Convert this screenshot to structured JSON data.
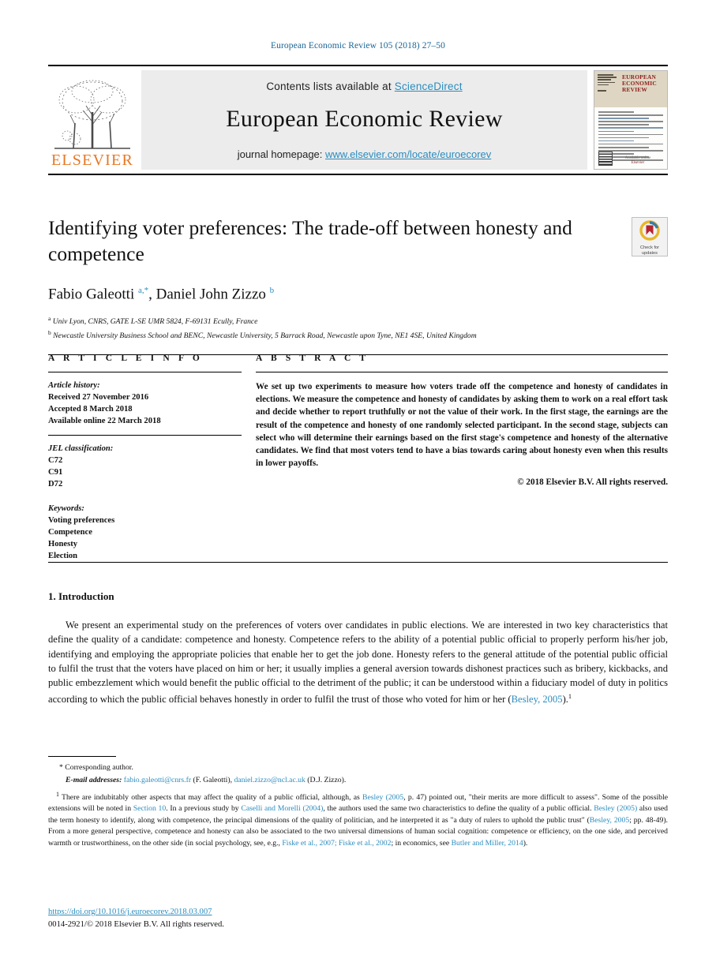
{
  "running_head": "European Economic Review 105 (2018) 27–50",
  "masthead": {
    "contents_prefix": "Contents lists available at ",
    "sciencedirect": "ScienceDirect",
    "journal_name": "European Economic Review",
    "homepage_prefix": "journal homepage: ",
    "homepage_url": "www.elsevier.com/locate/euroecorev",
    "publisher": "ELSEVIER",
    "cover_title": "EUROPEAN ECONOMIC REVIEW",
    "cover_caption": "Elsevier",
    "cover_caption2": "Available online"
  },
  "article": {
    "title": "Identifying voter preferences: The trade-off between honesty and competence",
    "crossmark_label": "Check for updates",
    "authors_html": "Fabio Galeotti <sup>a,*</sup>, Daniel John Zizzo <sup>b</sup>",
    "affiliation_a": "Univ Lyon, CNRS, GATE L-SE UMR 5824, F-69131 Ecully, France",
    "affiliation_b": "Newcastle University Business School and BENC, Newcastle University, 5 Barrack Road, Newcastle upon Tyne, NE1 4SE, United Kingdom"
  },
  "info": {
    "heading": "A R T I C L E   I N F O",
    "history_title": "Article history:",
    "history": [
      "Received 27 November 2016",
      "Accepted 8 March 2018",
      "Available online 22 March 2018"
    ],
    "jel_title": "JEL classification:",
    "jel": [
      "C72",
      "C91",
      "D72"
    ],
    "keywords_title": "Keywords:",
    "keywords": [
      "Voting preferences",
      "Competence",
      "Honesty",
      "Election"
    ]
  },
  "abstract": {
    "heading": "A B S T R A C T",
    "text": "We set up two experiments to measure how voters trade off the competence and honesty of candidates in elections. We measure the competence and honesty of candidates by asking them to work on a real effort task and decide whether to report truthfully or not the value of their work. In the first stage, the earnings are the result of the competence and honesty of one randomly selected participant. In the second stage, subjects can select who will determine their earnings based on the first stage's competence and honesty of the alternative candidates. We find that most voters tend to have a bias towards caring about honesty even when this results in lower payoffs.",
    "copyright": "© 2018 Elsevier B.V. All rights reserved."
  },
  "introduction": {
    "heading": "1. Introduction",
    "paragraph_html": "We present an experimental study on the preferences of voters over candidates in public elections. We are interested in two key characteristics that define the quality of a candidate: competence and honesty. Competence refers to the ability of a potential public official to properly perform his/her job, identifying and employing the appropriate policies that enable her to get the job done. Honesty refers to the general attitude of the potential public official to fulfil the trust that the voters have placed on him or her; it usually implies a general aversion towards dishonest practices such as bribery, kickbacks, and public embezzlement which would benefit the public official to the detriment of the public; it can be understood within a fiduciary model of duty in politics according to which the public official behaves honestly in order to fulfil the trust of those who voted for him or her (<span class=\"ref\">Besley, 2005</span>).<sup class=\"fn\">1</sup>"
  },
  "footnotes": {
    "corresponding": "* Corresponding author.",
    "emails_html": "<span class=\"lbl\">E-mail addresses:</span> <span class=\"ref\">fabio.galeotti@cnrs.fr</span> (F. Galeotti), <span class=\"ref\">daniel.zizzo@ncl.ac.uk</span> (D.J. Zizzo).",
    "note1_html": "<sup>1</sup> There are indubitably other aspects that may affect the quality of a public official, although, as <span class=\"ref\">Besley (2005</span>, p. 47) pointed out, \"their merits are more difficult to assess\". Some of the possible extensions will be noted in <span class=\"ref\">Section 10</span>. In a previous study by <span class=\"ref\">Caselli and Morelli (2004)</span>, the authors used the same two characteristics to define the quality of a public official. <span class=\"ref\">Besley (2005)</span> also used the term honesty to identify, along with competence, the principal dimensions of the quality of politician, and he interpreted it as \"a duty of rulers to uphold the public trust\" (<span class=\"ref\">Besley, 2005</span>; pp. 48-49). From a more general perspective, competence and honesty can also be associated to the two universal dimensions of human social cognition: competence or efficiency, on the one side, and perceived warmth or trustworthiness, on the other side (in social psychology, see, e.g., <span class=\"ref\">Fiske et al., 2007; Fiske et al., 2002</span>; in economics, see <span class=\"ref\">Butler and Miller, 2014</span>)."
  },
  "publication": {
    "doi": "https://doi.org/10.1016/j.euroecorev.2018.03.007",
    "issn_line": "0014-2921/© 2018 Elsevier B.V. All rights reserved."
  },
  "colors": {
    "link": "#2b8cbe",
    "running_head": "#1a6496",
    "elsevier_orange": "#E87722",
    "crossmark_red": "#b5232f",
    "crossmark_yellow": "#e8b62c",
    "cover_band": "#ded6c2",
    "cover_title": "#8c1d1d"
  }
}
